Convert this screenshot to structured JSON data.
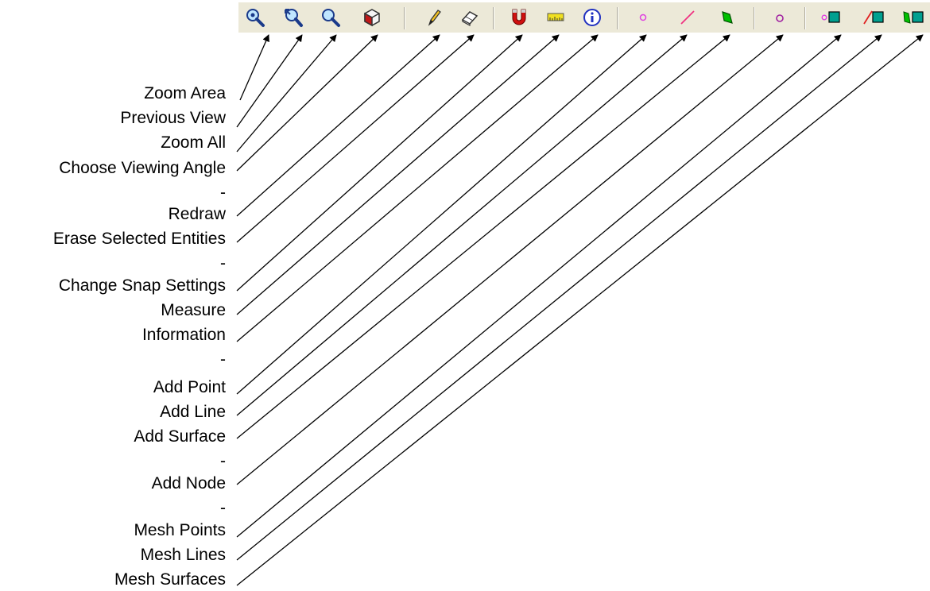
{
  "toolbar": {
    "buttons": [
      {
        "name": "zoom-area-icon",
        "icon": "magnifier-zoom-area"
      },
      {
        "name": "previous-view-icon",
        "icon": "magnifier-previous"
      },
      {
        "name": "zoom-all-icon",
        "icon": "magnifier-zoom-all"
      },
      {
        "name": "viewing-angle-icon",
        "icon": "cube-view"
      },
      {
        "name": "redraw-icon",
        "icon": "pencil"
      },
      {
        "name": "erase-icon",
        "icon": "eraser"
      },
      {
        "name": "snap-icon",
        "icon": "magnet"
      },
      {
        "name": "measure-icon",
        "icon": "ruler"
      },
      {
        "name": "information-icon",
        "icon": "info-circle"
      },
      {
        "name": "add-point-icon",
        "icon": "point-circle"
      },
      {
        "name": "add-line-icon",
        "icon": "line"
      },
      {
        "name": "add-surface-icon",
        "icon": "surface"
      },
      {
        "name": "add-node-icon",
        "icon": "node-circle"
      },
      {
        "name": "mesh-points-icon",
        "icon": "mesh-point"
      },
      {
        "name": "mesh-lines-icon",
        "icon": "mesh-line"
      },
      {
        "name": "mesh-surfaces-icon",
        "icon": "mesh-surface"
      }
    ],
    "colors": {
      "background": "#ece9d8",
      "magenta": "#e040e0",
      "green": "#00c000",
      "teal": "#00a090"
    }
  },
  "labels": [
    "Zoom Area",
    "Previous View",
    "Zoom All",
    "Choose Viewing Angle",
    "-",
    "Redraw",
    "Erase Selected Entities",
    "-",
    "Change Snap Settings",
    "Measure",
    "Information",
    "-",
    "Add Point",
    "Add Line",
    "Add Surface",
    "-",
    "Add Node",
    "-",
    "Mesh Points",
    "Mesh Lines",
    "Mesh Surfaces"
  ]
}
